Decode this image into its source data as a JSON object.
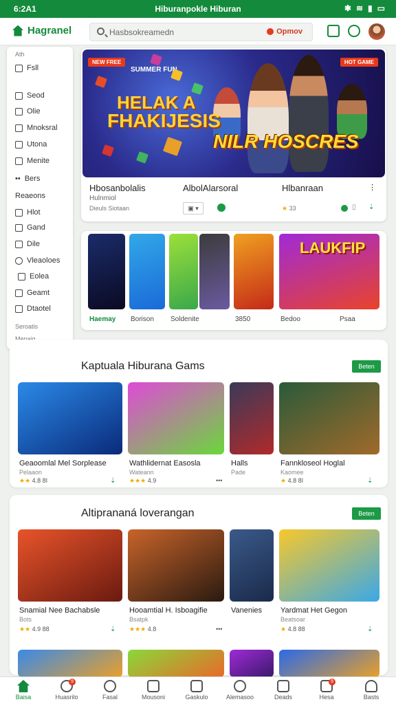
{
  "status_bar": {
    "time": "6:2A1",
    "center_text": "Hiburanpokle Hiburan",
    "icons": [
      "bluetooth-icon",
      "wifi-icon",
      "signal-icon",
      "battery-icon"
    ]
  },
  "header": {
    "logo_text": "Hagranel",
    "search": {
      "placeholder": "Hasbsokreamedn",
      "chip_label": "Opmov"
    },
    "icons": [
      "tablet-icon",
      "refresh-icon",
      "avatar"
    ]
  },
  "sidebar": {
    "top_label": "Ath",
    "items": [
      {
        "label": "Fsll",
        "icon": "grid-icon"
      },
      {
        "label": "Seod",
        "icon": "calendar-icon"
      },
      {
        "label": "Olie",
        "icon": "chat-icon"
      },
      {
        "label": "Mnoksral",
        "icon": "list-icon"
      },
      {
        "label": "Utona",
        "icon": "photo-icon"
      },
      {
        "label": "Menite",
        "icon": "edit-icon"
      },
      {
        "label": "Bers",
        "icon": "dots-icon"
      },
      {
        "label": "Reaeons",
        "icon": "none"
      },
      {
        "label": "Hlot",
        "icon": "grid-icon"
      },
      {
        "label": "Gand",
        "icon": "calendar-icon"
      },
      {
        "label": "Dile",
        "icon": "doc-icon"
      },
      {
        "label": "Vleaoloes",
        "icon": "search-icon"
      },
      {
        "label": "Eolea",
        "icon": "tag-icon"
      },
      {
        "label": "Geamt",
        "icon": "gift-icon"
      },
      {
        "label": "Dtaotel",
        "icon": "box-icon"
      }
    ],
    "footer_1": "Seroatis",
    "footer_2": "Mepaig"
  },
  "featured": {
    "tag_left": "NEW FREE",
    "tag_right": "HOT GAME",
    "subtitle": "SUMMER FUN",
    "title_line1": "HELAK A",
    "title_line2": "FHAKIJESIS",
    "title_logo": "NILR HOSCRES",
    "meta": [
      {
        "title": "Hbosanbolalis",
        "sub": "Hulnmiol",
        "foot": "Dieuls Siotaan"
      },
      {
        "title": "AlbolAlarsoral",
        "sub": "",
        "foot": ""
      },
      {
        "title": "Hlbanraan",
        "sub": "",
        "foot": "33"
      }
    ]
  },
  "categories": [
    {
      "label": "Haemay"
    },
    {
      "label": "Borison"
    },
    {
      "label": "Soldenite"
    },
    {
      "label": "3850"
    },
    {
      "label": "Bedoo"
    },
    {
      "label": "Psaa"
    }
  ],
  "section_1": {
    "title": "Kaptuala Hiburana Gams",
    "button": "Beten",
    "games": [
      {
        "title": "Geaoomlal Mel Sorplease",
        "sub": "Pelaaon",
        "rating": "4.8 8I"
      },
      {
        "title": "Wathlidernat Easosla",
        "sub": "Wateann",
        "rating": "4.9"
      },
      {
        "title": "Halls",
        "sub": "Pade",
        "rating": ""
      },
      {
        "title": "Fannkloseol Hoglal",
        "sub": "Kaomee",
        "rating": "4.8 8I"
      }
    ]
  },
  "section_2": {
    "title": "Altiprananá loverangan",
    "button": "Beten",
    "games": [
      {
        "title": "Snamial Nee Bachabsle",
        "sub": "Bots",
        "rating": "4.9 88"
      },
      {
        "title": "Hooamtial H. Isboagifie",
        "sub": "Bsatpk",
        "rating": "4.8"
      },
      {
        "title": "Vanenies",
        "sub": "",
        "rating": ""
      },
      {
        "title": "Yardmat Het Gegon",
        "sub": "Beatsoar",
        "rating": "4.8 88"
      }
    ]
  },
  "bottom_nav": [
    {
      "label": "Baisa",
      "icon": "home-icon",
      "active": true
    },
    {
      "label": "Huasrilo",
      "icon": "gamepad-icon",
      "badge": "9"
    },
    {
      "label": "Fasal",
      "icon": "people-icon"
    },
    {
      "label": "Mousoni",
      "icon": "camera-icon"
    },
    {
      "label": "Gaskulo",
      "icon": "store-icon"
    },
    {
      "label": "Alemasoo",
      "icon": "search-icon"
    },
    {
      "label": "Deads",
      "icon": "calendar-icon"
    },
    {
      "label": "Hesa",
      "icon": "message-icon",
      "badge": "9"
    },
    {
      "label": "Basts",
      "icon": "user-icon"
    }
  ],
  "colors": {
    "brand": "#148a3c",
    "accent": "#1c9a46",
    "alert": "#e53b1f"
  }
}
